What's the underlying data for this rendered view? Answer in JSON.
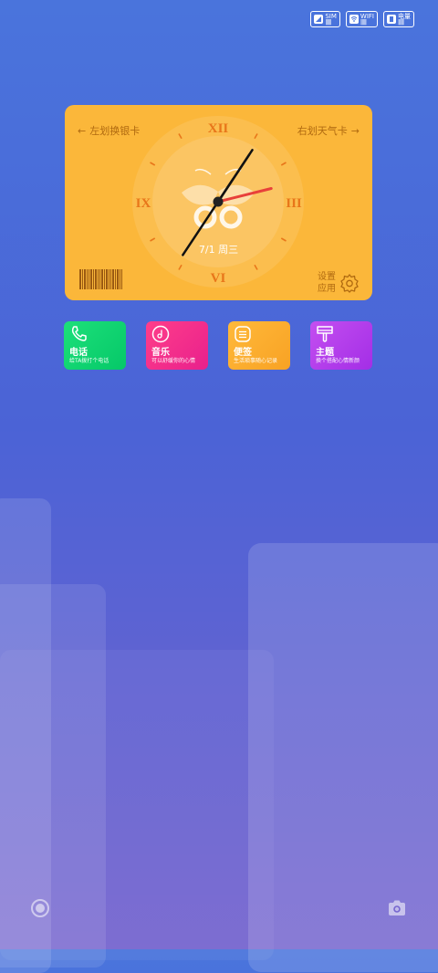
{
  "status": {
    "sim_label": "SIM",
    "wifi_label": "WIFI",
    "battery_label": "电量"
  },
  "card": {
    "left_hint": "左划换银卡",
    "right_hint": "右划天气卡",
    "date": "7/1 周三",
    "settings_line1": "设置",
    "settings_line2": "应用",
    "numerals": {
      "top": "XII",
      "right": "III",
      "bottom": "VI",
      "left": "IX"
    },
    "time": {
      "hour": 1,
      "minute": 7,
      "second": 14
    }
  },
  "tiles": [
    {
      "name": "电话",
      "desc": "给TA拨打个电话"
    },
    {
      "name": "音乐",
      "desc": "可以舒缓你的心情"
    },
    {
      "name": "便签",
      "desc": "生活琐事随心记录"
    },
    {
      "name": "主题",
      "desc": "换个搭配心情新颜"
    }
  ],
  "colors": {
    "card": "#fbb73a",
    "numeral": "#e8761a",
    "second_hand": "#e8403a",
    "phone": "#05c868",
    "music": "#e8208c",
    "note": "#f8a224",
    "theme": "#a32ee6"
  },
  "icons": {
    "bottom_left": "record-icon",
    "bottom_right": "camera-icon"
  }
}
